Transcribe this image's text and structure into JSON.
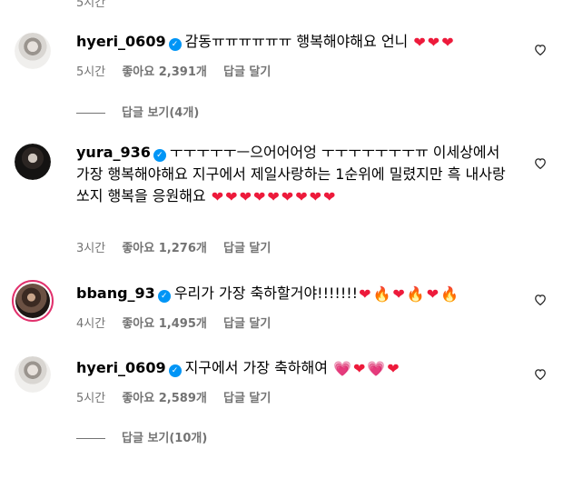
{
  "top_fragment": "5시간",
  "comments": [
    {
      "username": "hyeri_0609",
      "text": "감동ㅠㅠㅠㅠㅠㅠ 행복해야해요 언니",
      "emojis": [
        "❤",
        "❤",
        "❤"
      ],
      "time": "5시간",
      "likes": "좋아요 2,391개",
      "reply": "답글 달기",
      "view_replies": "답글 보기(4개)"
    },
    {
      "username": "yura_936",
      "text": "ㅜㅜㅜㅜㅜㅡ으어어어엉 ㅜㅜㅜㅜㅜㅜㅜㅠ 이세상에서 가장 행복해야해요 지구에서 제일사랑하는 1순위에 밀렸지만 흑 내사랑 쏘지 행복을 응원해요",
      "emojis": [
        "❤",
        "❤",
        "❤",
        "❤",
        "❤",
        "❤",
        "❤",
        "❤",
        "❤"
      ],
      "time": "3시간",
      "likes": "좋아요 1,276개",
      "reply": "답글 달기"
    },
    {
      "username": "bbang_93",
      "text": "우리가 가장 축하할거야!!!!!!!",
      "emojis": [
        "❤",
        "🔥",
        "❤",
        "🔥",
        "❤",
        "🔥"
      ],
      "time": "4시간",
      "likes": "좋아요 1,495개",
      "reply": "답글 달기"
    },
    {
      "username": "hyeri_0609",
      "text": "지구에서 가장 축하해여",
      "emojis": [
        "💗",
        "❤",
        "💗",
        "❤"
      ],
      "time": "5시간",
      "likes": "좋아요 2,589개",
      "reply": "답글 달기",
      "view_replies": "답글 보기(10개)"
    }
  ],
  "colors": {
    "verified": "#0095f6",
    "heart": "#ed1a3b",
    "fire": "#ff7a00",
    "secondary_text": "#737373",
    "story_ring": "#e1306c"
  },
  "icons": {
    "verified": "verified-badge-icon",
    "like": "heart-outline-icon"
  }
}
